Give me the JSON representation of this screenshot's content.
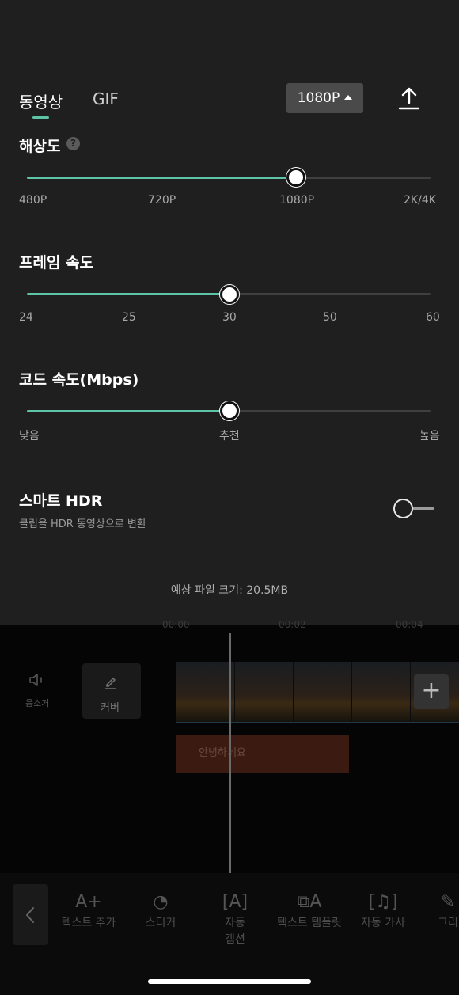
{
  "sheet": {
    "tabs": [
      {
        "label": "동영상",
        "selected": true
      },
      {
        "label": "GIF",
        "selected": false
      }
    ],
    "resolution_button": "1080P",
    "accent_color": "#5ec4a8",
    "resolution": {
      "title": "해상도",
      "help": "?",
      "ticks": [
        "480P",
        "720P",
        "1080P",
        "2K/4K"
      ],
      "selected": "1080P"
    },
    "frame_rate": {
      "title": "프레임 속도",
      "ticks": [
        "24",
        "25",
        "30",
        "50",
        "60"
      ],
      "selected": "30"
    },
    "bitrate": {
      "title": "코드 속도(Mbps)",
      "ticks": [
        "낮음",
        "추천",
        "높음"
      ],
      "selected": "추천"
    },
    "smart_hdr": {
      "title": "스마트 HDR",
      "subtitle": "클립을 HDR 동영상으로 변환",
      "enabled": false
    },
    "file_size": "예상 파일 크기: 20.5MB"
  },
  "editor": {
    "timecodes": [
      "00:00",
      "00:02",
      "00:04"
    ],
    "mute_label": "음소거",
    "cover_label": "커버",
    "add_label": "+",
    "text_clip": "안녕하세요",
    "tools": [
      {
        "icon": "A+",
        "label": "텍스트 추가",
        "label2": ""
      },
      {
        "icon": "◔",
        "label": "스티커",
        "label2": ""
      },
      {
        "icon": "[A]",
        "label": "자동",
        "label2": "캡션"
      },
      {
        "icon": "⧉A",
        "label": "텍스트 템플릿",
        "label2": ""
      },
      {
        "icon": "[♫]",
        "label": "자동 가사",
        "label2": ""
      },
      {
        "icon": "✎",
        "label": "그리",
        "label2": ""
      }
    ]
  }
}
